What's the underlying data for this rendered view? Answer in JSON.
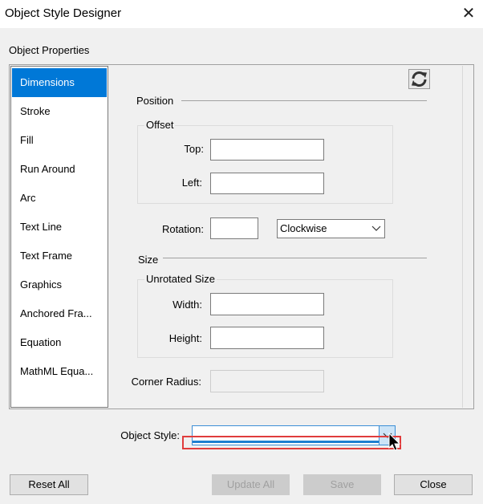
{
  "window": {
    "title": "Object Style Designer",
    "close_glyph": "✕"
  },
  "group_label": "Object Properties",
  "categories": [
    {
      "label": "Dimensions",
      "selected": true
    },
    {
      "label": "Stroke",
      "selected": false
    },
    {
      "label": "Fill",
      "selected": false
    },
    {
      "label": "Run Around",
      "selected": false
    },
    {
      "label": "Arc",
      "selected": false
    },
    {
      "label": "Text Line",
      "selected": false
    },
    {
      "label": "Text Frame",
      "selected": false
    },
    {
      "label": "Graphics",
      "selected": false
    },
    {
      "label": "Anchored Fra...",
      "selected": false
    },
    {
      "label": "Equation",
      "selected": false
    },
    {
      "label": "MathML Equa...",
      "selected": false
    }
  ],
  "position": {
    "section_label": "Position",
    "offset_label": "Offset",
    "top_label": "Top:",
    "top_value": "",
    "left_label": "Left:",
    "left_value": "",
    "rotation_label": "Rotation:",
    "rotation_value": "",
    "direction_value": "Clockwise"
  },
  "size": {
    "section_label": "Size",
    "unrotated_label": "Unrotated Size",
    "width_label": "Width:",
    "width_value": "",
    "height_label": "Height:",
    "height_value": "",
    "corner_radius_label": "Corner Radius:",
    "corner_radius_value": ""
  },
  "object_style": {
    "label": "Object Style:",
    "value": ""
  },
  "buttons": {
    "reset_all": "Reset All",
    "update_all": "Update All",
    "save": "Save",
    "close": "Close"
  },
  "icons": {
    "refresh": "refresh-icon",
    "dropdown": "chevron-down-icon"
  },
  "colors": {
    "selection": "#0078d7",
    "highlight": "#e03c3c",
    "focus": "#3c8fd6"
  }
}
